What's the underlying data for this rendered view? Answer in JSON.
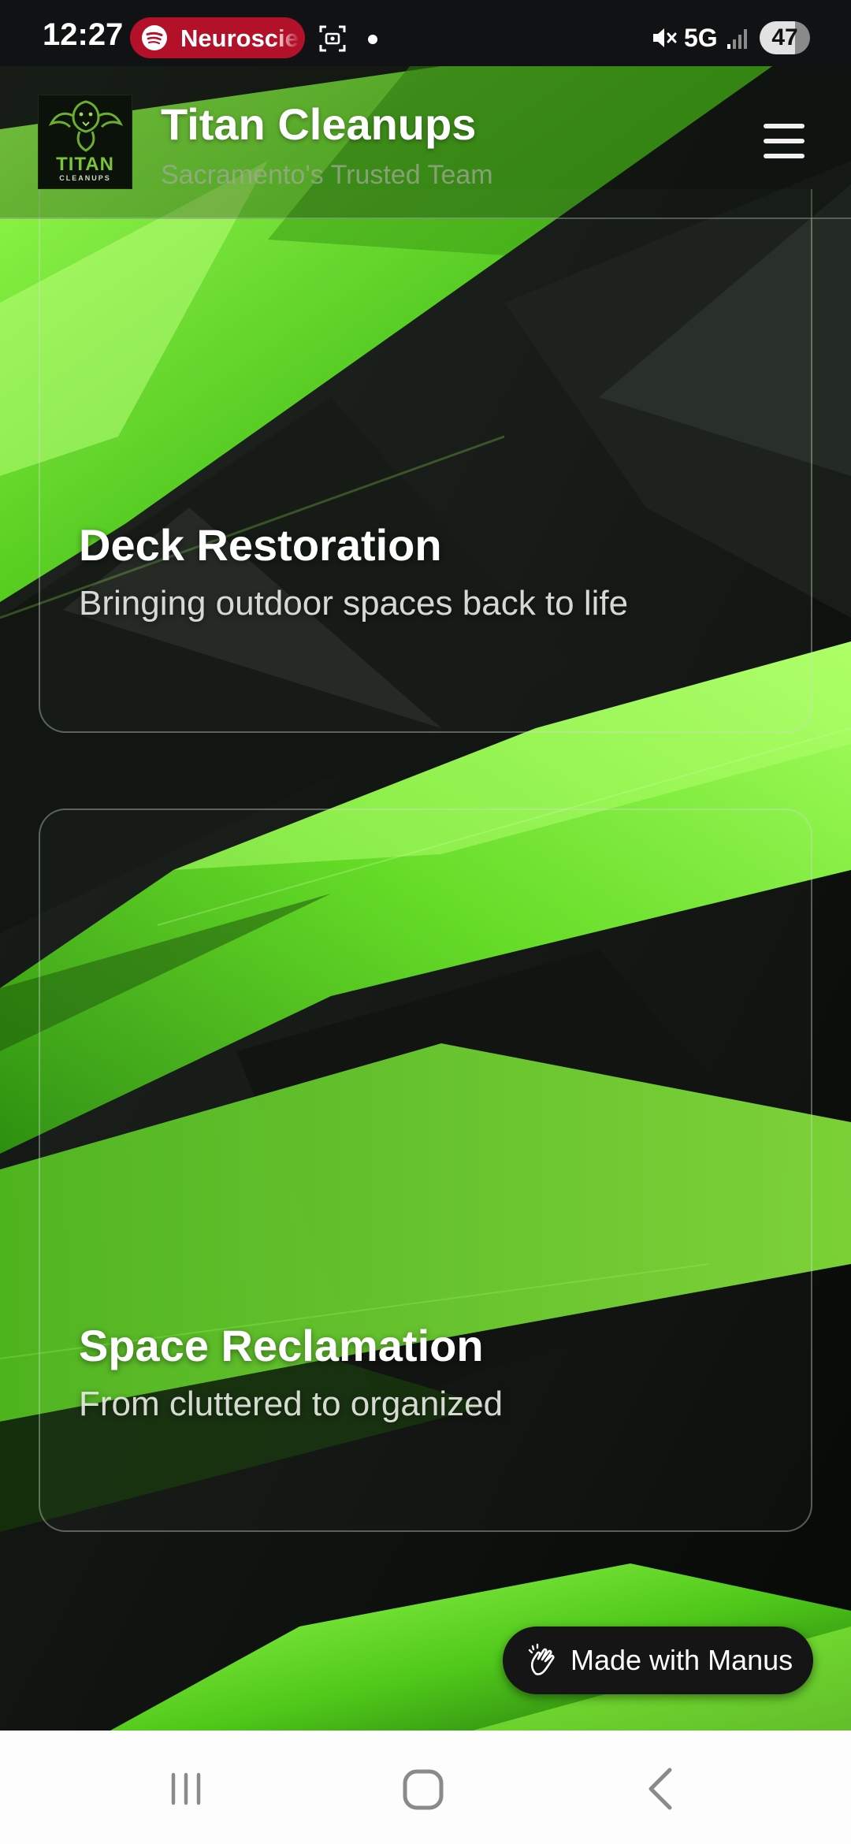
{
  "status_bar": {
    "time": "12:27",
    "media_pill": {
      "label": "Neuroscie",
      "color": "#b3112a",
      "icon": "spotify-icon"
    },
    "network": "5G",
    "battery": "47",
    "icons": [
      "screenshot-icon",
      "notification-dot",
      "mute-icon",
      "signal-icon"
    ]
  },
  "header": {
    "logo": {
      "word": "TITAN",
      "sub": "CLEANUPS",
      "icon": "dragon-logo"
    },
    "title": "Titan Cleanups",
    "tagline": "Sacramento's Trusted Team",
    "menu_icon": "hamburger-menu-icon"
  },
  "cards": [
    {
      "title": "Deck Restoration",
      "subtitle": "Bringing outdoor spaces back to life"
    },
    {
      "title": "Space Reclamation",
      "subtitle": "From cluttered to organized"
    }
  ],
  "badge": {
    "label": "Made with Manus",
    "icon": "manus-hand-icon"
  },
  "nav_bar": {
    "icons": [
      "recents-icon",
      "home-icon",
      "back-icon"
    ]
  },
  "colors": {
    "accent_green": "#6fe02a",
    "dark_background": "#0b0d0b",
    "status_bar": "#101214",
    "nav_bar": "#fdfdfd"
  }
}
